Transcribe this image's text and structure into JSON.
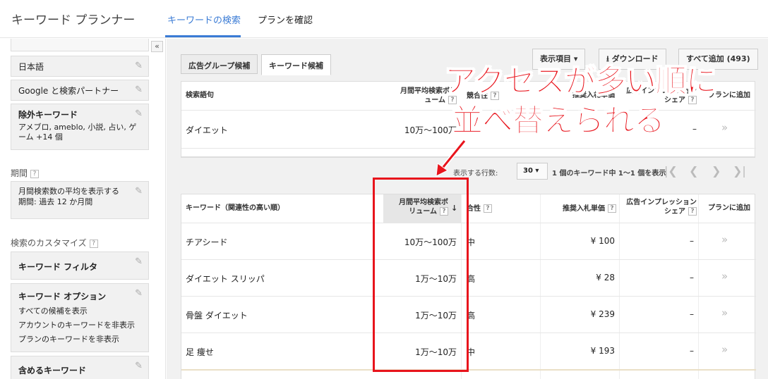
{
  "app": {
    "title": "キーワード プランナー"
  },
  "top_tabs": [
    {
      "label": "キーワードの検索"
    },
    {
      "label": "プランを確認"
    }
  ],
  "sidebar": {
    "collapse": "«",
    "language": "日本語",
    "network": "Google と検索パートナー",
    "negative": {
      "title": "除外キーワード",
      "text": "アメブロ, ameblo, 小説, 占い, ゲーム +14 個"
    },
    "period_label": "期間",
    "period": {
      "line1": "月間検索数の平均を表示する",
      "line2": "期間: 過去 12 か月間"
    },
    "customize_label": "検索のカスタマイズ",
    "filter": "キーワード フィルタ",
    "options": {
      "title": "キーワード オプション",
      "items": [
        "すべての候補を表示",
        "アカウントのキーワードを非表示",
        "プランのキーワードを非表示"
      ]
    },
    "include": "含めるキーワード",
    "help": "?"
  },
  "subtabs": [
    {
      "label": "広告グループ候補"
    },
    {
      "label": "キーワード候補"
    }
  ],
  "toolbar": {
    "columns": "表示項目 ▾",
    "download": "ダウンロード",
    "add_all": "すべて追加 (493)"
  },
  "search_table": {
    "headers": {
      "term": "検索語句",
      "volume_1": "月間平均検索ボリ",
      "volume_2": "ューム",
      "competition": "競合性",
      "bid": "推奨入札単価",
      "share": "広告インプレッション",
      "share_2": "シェア",
      "add": "プランに追加"
    },
    "row": {
      "term": "ダイエット",
      "volume": "10万～100万",
      "bid": "¥",
      "share": "–",
      "add": "»"
    }
  },
  "pager": {
    "rows_label": "表示する行数:",
    "rows_value": "30 ▾",
    "count": "1 個のキーワード中 1～1 個を表示"
  },
  "kw_table": {
    "headers": {
      "keyword": "キーワード（関連性の高い順）",
      "volume_1": "月間平均検索ボ",
      "volume_2": "リューム",
      "competition": "合性",
      "bid": "推奨入札単価",
      "share_1": "広告インプレッション",
      "share_2": "シェア",
      "add": "プランに追加"
    },
    "rows": [
      {
        "keyword": "チアシード",
        "volume": "10万～100万",
        "competition": "中",
        "bid": "¥ 100",
        "share": "–",
        "add": "»"
      },
      {
        "keyword": "ダイエット スリッパ",
        "volume": "1万～10万",
        "competition": "高",
        "bid": "¥ 28",
        "share": "–",
        "add": "»"
      },
      {
        "keyword": "骨盤 ダイエット",
        "volume": "1万～10万",
        "competition": "高",
        "bid": "¥ 239",
        "share": "–",
        "add": "»"
      },
      {
        "keyword": "足 痩せ",
        "volume": "1万～10万",
        "competition": "中",
        "bid": "¥ 193",
        "share": "–",
        "add": "»"
      }
    ]
  },
  "annotation": {
    "line1": "アクセスが多い順に",
    "line2": "並べ替えられる",
    "color": "#e8141c"
  },
  "accent_color": "#3a7bd5"
}
